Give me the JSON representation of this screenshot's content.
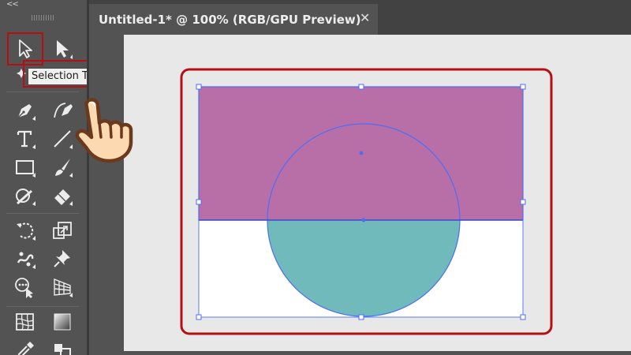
{
  "app": {
    "collapse_label": "<<",
    "document_tab": {
      "title": "Untitled-1* @ 100% (RGB/GPU Preview)",
      "close_label": "✕"
    }
  },
  "tooltip": {
    "text": "Selection Tool (V)"
  },
  "tools": [
    {
      "name": "selection-tool",
      "icon": "selection-arrow-icon",
      "active": true
    },
    {
      "name": "direct-selection-tool",
      "icon": "direct-selection-arrow-icon"
    },
    {
      "name": "magic-wand-tool",
      "icon": "magic-wand-icon"
    },
    {
      "name": "lasso-tool",
      "icon": "lasso-icon"
    },
    {
      "name": "pen-tool",
      "icon": "pen-icon"
    },
    {
      "name": "curvature-tool",
      "icon": "curvature-icon"
    },
    {
      "name": "type-tool",
      "icon": "type-icon"
    },
    {
      "name": "line-segment-tool",
      "icon": "line-segment-icon"
    },
    {
      "name": "rectangle-tool",
      "icon": "rectangle-icon"
    },
    {
      "name": "paintbrush-tool",
      "icon": "paintbrush-icon"
    },
    {
      "name": "shaper-tool",
      "icon": "shaper-icon"
    },
    {
      "name": "eraser-tool",
      "icon": "eraser-icon"
    },
    {
      "name": "rotate-tool",
      "icon": "rotate-icon"
    },
    {
      "name": "scale-tool",
      "icon": "scale-icon"
    },
    {
      "name": "puppet-warp-tool",
      "icon": "puppet-warp-icon"
    },
    {
      "name": "pin-tool",
      "icon": "pin-icon"
    },
    {
      "name": "shape-builder-tool",
      "icon": "shape-builder-icon"
    },
    {
      "name": "perspective-grid-tool",
      "icon": "perspective-grid-icon"
    },
    {
      "name": "mesh-tool",
      "icon": "mesh-icon"
    },
    {
      "name": "gradient-tool",
      "icon": "gradient-icon"
    },
    {
      "name": "eyedropper-tool",
      "icon": "eyedropper-icon"
    },
    {
      "name": "blend-tool",
      "icon": "blend-icon"
    }
  ],
  "artwork": {
    "rectangle_fill": "#b86fa8",
    "circle_fill": "#71babc",
    "selection_color": "#4c6ef5",
    "highlight_color": "#b50f15",
    "pointer_hand": "pointer-hand-icon"
  }
}
